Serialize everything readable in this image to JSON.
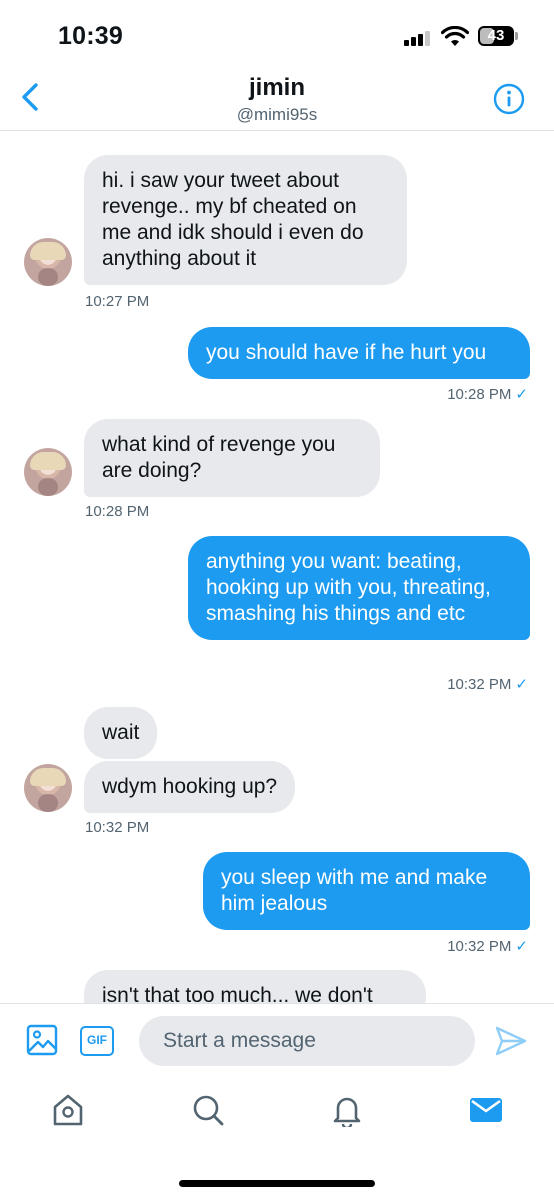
{
  "status_bar": {
    "time": "10:39",
    "battery": "43",
    "battery_level": 0.43
  },
  "header": {
    "name": "jimin",
    "handle": "@mimi95s",
    "back_icon": "chevron-left-icon",
    "info_icon": "info-icon",
    "accent": "#1d9bf0"
  },
  "messages": [
    {
      "text": "hi. i saw your tweet about revenge.. my bf cheated on me and idk should i even do anything about it",
      "time": "10:27 PM",
      "direction": "received"
    },
    {
      "text": "you should have if he hurt you",
      "time": "10:28 PM",
      "direction": "sent",
      "read": "✓"
    },
    {
      "text": "what kind of revenge you are doing?",
      "time": "10:28 PM",
      "direction": "received"
    },
    {
      "text": "anything you want: beating, hooking up with you, threating, smashing his things and etc",
      "time": "10:32 PM",
      "direction": "sent",
      "read": "✓"
    },
    {
      "text": "wait",
      "direction": "received"
    },
    {
      "text": "wdym hooking up?",
      "time": "10:32 PM",
      "direction": "received"
    },
    {
      "text": "you sleep with me and make him jealous",
      "time": "10:32 PM",
      "direction": "sent",
      "read": "✓"
    },
    {
      "text": "isn't that too much... we don't",
      "direction": "received"
    }
  ],
  "composer": {
    "placeholder": "Start a message",
    "gif_label": "GIF",
    "media_icon": "image-icon",
    "send_icon": "send-icon"
  },
  "tabbar": {
    "items": [
      "home-icon",
      "search-icon",
      "notifications-icon",
      "messages-icon"
    ]
  },
  "colors": {
    "sent_bubble": "#1d9bf0",
    "received_bubble": "#e7e9ed"
  }
}
